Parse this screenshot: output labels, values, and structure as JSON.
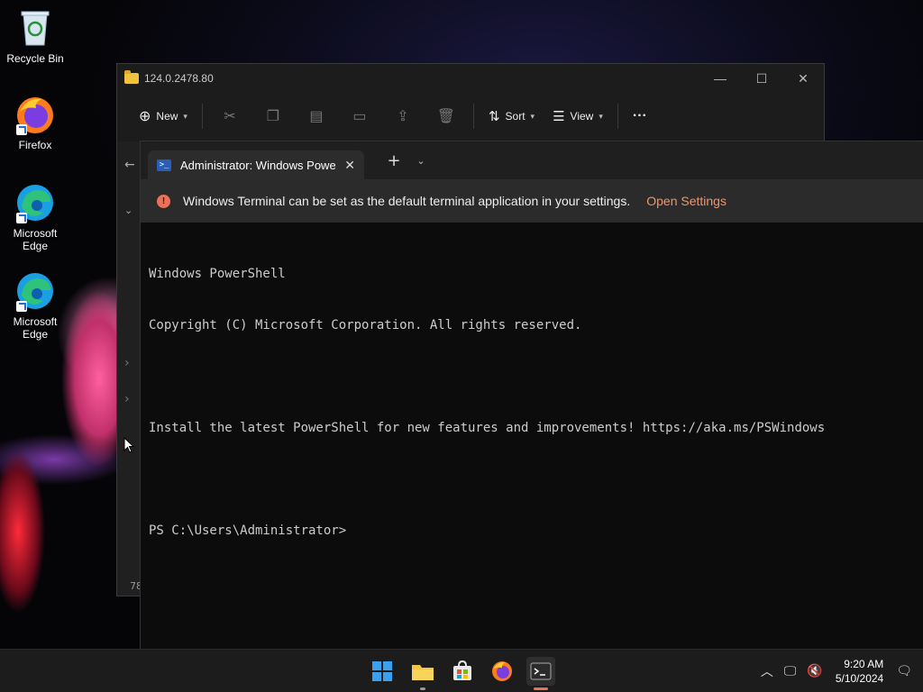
{
  "desktop": {
    "icons": [
      {
        "label": "Recycle Bin",
        "icon": "recycle-bin-icon"
      },
      {
        "label": "Firefox",
        "icon": "firefox-icon"
      },
      {
        "label": "Microsoft Edge",
        "icon": "edge-icon"
      },
      {
        "label": "Microsoft Edge",
        "icon": "edge-icon"
      }
    ]
  },
  "explorer": {
    "title": "124.0.2478.80",
    "toolbar": {
      "new_label": "New",
      "sort_label": "Sort",
      "view_label": "View",
      "more_label": "···"
    },
    "status_text": "78"
  },
  "terminal": {
    "tab_title": "Administrator: Windows Powe",
    "infobar": {
      "message": "Windows Terminal can be set as the default terminal application in your settings.",
      "link": "Open Settings"
    },
    "console": {
      "line1": "Windows PowerShell",
      "line2": "Copyright (C) Microsoft Corporation. All rights reserved.",
      "line3": "Install the latest PowerShell for new features and improvements! https://aka.ms/PSWindows",
      "prompt": "PS C:\\Users\\Administrator>"
    }
  },
  "taskbar": {
    "apps": [
      "start-icon",
      "file-explorer-icon",
      "microsoft-store-icon",
      "firefox-icon",
      "terminal-icon"
    ],
    "clock": {
      "time": "9:20 AM",
      "date": "5/10/2024"
    }
  },
  "colors": {
    "accent_link": "#f0956a",
    "info_icon": "#e8725a",
    "terminal_bg": "#0c0c0c"
  }
}
